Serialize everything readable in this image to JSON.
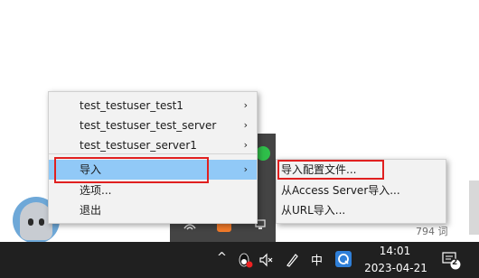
{
  "main_menu": {
    "items": [
      {
        "label": "test_testuser_test1",
        "submenu": true
      },
      {
        "label": "test_testuser_test_server",
        "submenu": true
      },
      {
        "label": "test_testuser_server1",
        "submenu": true
      },
      {
        "label": "导入",
        "submenu": true
      },
      {
        "label": "选项...",
        "submenu": false
      },
      {
        "label": "退出",
        "submenu": false
      }
    ],
    "highlighted_index": 3
  },
  "sub_menu": {
    "items": [
      {
        "label": "导入配置文件..."
      },
      {
        "label": "从Access Server导入..."
      },
      {
        "label": "从URL导入..."
      }
    ]
  },
  "arrow_glyph": "›",
  "editor": {
    "word_count": "794 词"
  },
  "taskbar": {
    "chevron": "^",
    "ime_mode": "中",
    "time": "14:01",
    "date": "2023-04-21",
    "notification_count": "2"
  },
  "colors": {
    "highlight": "#91c9f7",
    "annotation": "#e02020",
    "taskbar_bg": "#202020"
  }
}
